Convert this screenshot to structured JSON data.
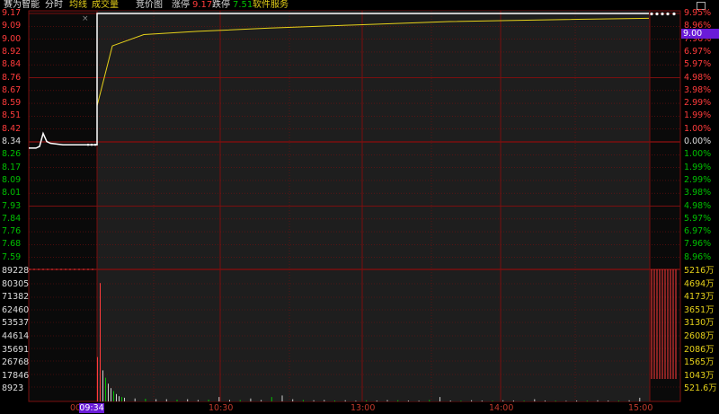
{
  "header": {
    "stock_name": "赛为智能",
    "tab_timeshare": "分时",
    "legend_avg": "均线",
    "legend_volume": "成交量",
    "legend_auction": "竞价图",
    "limit_up_label": "涨停",
    "limit_up_value": "9.17",
    "limit_down_label": "跌停",
    "limit_down_value": "7.51",
    "software_service": "软件服务"
  },
  "price_axis": {
    "left": [
      "9.17",
      "9.09",
      "9.00",
      "8.92",
      "8.84",
      "8.76",
      "8.67",
      "8.59",
      "8.51",
      "8.42",
      "8.34",
      "8.26",
      "8.17",
      "8.09",
      "8.01",
      "7.93",
      "7.84",
      "7.76",
      "7.68",
      "7.59"
    ],
    "right": [
      "9.95%",
      "8.96%",
      "7.96%",
      "6.97%",
      "5.97%",
      "4.98%",
      "3.98%",
      "2.99%",
      "1.99%",
      "1.00%",
      "0.00%",
      "1.00%",
      "1.99%",
      "2.99%",
      "3.98%",
      "4.98%",
      "5.97%",
      "6.97%",
      "7.96%",
      "8.96%"
    ]
  },
  "current_price": "9.00",
  "volume_axis": {
    "left": [
      "89228",
      "80305",
      "71382",
      "62460",
      "53537",
      "44614",
      "35691",
      "26768",
      "17846",
      "8923"
    ],
    "right": [
      "5216万",
      "4694万",
      "4173万",
      "3651万",
      "3130万",
      "2608万",
      "2086万",
      "1565万",
      "1043万",
      "521.6万"
    ]
  },
  "time_axis": {
    "pre_label": "00",
    "current_time": "09:34",
    "ticks": [
      "10:30",
      "13:00",
      "14:00",
      "15:00"
    ]
  },
  "colors": {
    "background": "#000000",
    "grid": "#7a0f0f",
    "price_line": "#ffffff",
    "avg_line": "#e6d11a",
    "up": "#ff3b3b",
    "down": "#00c000",
    "highlight": "#6a1bd8"
  },
  "chart_data": {
    "type": "line",
    "series": [
      {
        "values": [
          8.34,
          8.34,
          8.35,
          8.43,
          8.38,
          8.37,
          8.36,
          8.36,
          8.36,
          9.17,
          9.17,
          9.17,
          9.17,
          9.17,
          9.17,
          9.17,
          9.17,
          9.17
        ]
      },
      {
        "values": [
          8.34,
          8.34,
          8.35,
          8.39,
          8.38,
          8.37,
          8.37,
          8.36,
          8.36,
          8.6,
          8.97,
          9.04,
          9.06,
          9.08,
          9.1,
          9.12,
          9.13,
          9.14
        ]
      }
    ],
    "ylim": [
      7.59,
      9.17
    ],
    "volume": {
      "values": [
        30000,
        80000,
        21000,
        16000,
        12000,
        9000,
        7000,
        5000,
        3500,
        3000,
        2500,
        2000,
        1800,
        1500,
        1500,
        1200,
        1500,
        1000,
        1200,
        3000,
        1000,
        1000,
        2000,
        1000,
        3000,
        4000,
        1500,
        1000,
        800,
        1000,
        600,
        800,
        500,
        700,
        600,
        900,
        800,
        600,
        500,
        1000,
        3000,
        600,
        500,
        800,
        600,
        500,
        700,
        600,
        500,
        1500,
        600,
        500,
        400,
        600,
        500,
        700,
        600,
        500,
        700,
        2500
      ],
      "ylim": [
        0,
        89228
      ]
    }
  }
}
